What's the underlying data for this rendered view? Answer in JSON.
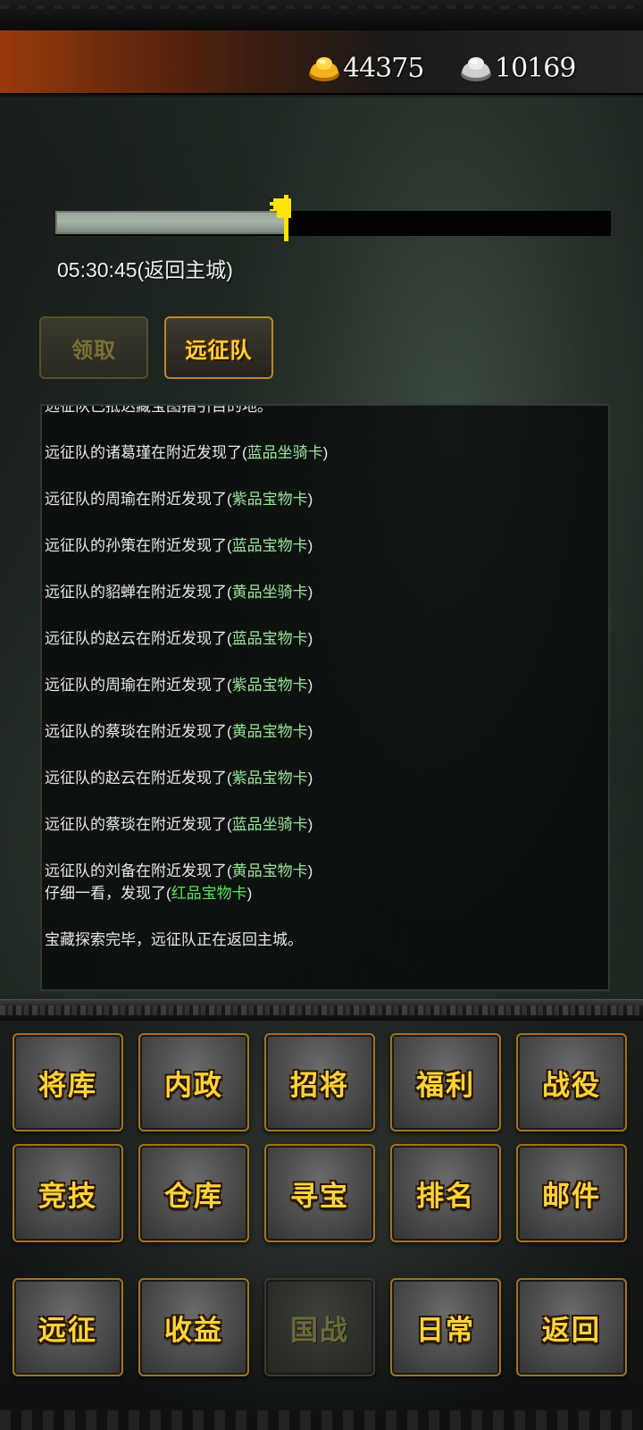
{
  "currency": {
    "gold": {
      "icon": "gold-ingot-icon",
      "value": "44375"
    },
    "silver": {
      "icon": "silver-ingot-icon",
      "value": "10169"
    }
  },
  "expedition": {
    "progress": 0.42,
    "timer_text": "05:30:45(返回主城)",
    "buttons": {
      "claim": "领取",
      "team": "远征队"
    }
  },
  "log": {
    "lines": [
      {
        "text": "远征队已抵达藏宝图指引目的地。"
      },
      {
        "text": "远征队的诸葛瑾在附近发现了(",
        "item": "蓝品坐骑卡",
        "tail": ")"
      },
      {
        "text": "远征队的周瑜在附近发现了(",
        "item": "紫品宝物卡",
        "tail": ")"
      },
      {
        "text": "远征队的孙策在附近发现了(",
        "item": "蓝品宝物卡",
        "tail": ")"
      },
      {
        "text": "远征队的貂蝉在附近发现了(",
        "item": "黄品坐骑卡",
        "tail": ")"
      },
      {
        "text": "远征队的赵云在附近发现了(",
        "item": "蓝品宝物卡",
        "tail": ")"
      },
      {
        "text": "远征队的周瑜在附近发现了(",
        "item": "紫品宝物卡",
        "tail": ")"
      },
      {
        "text": "远征队的蔡琰在附近发现了(",
        "item": "黄品宝物卡",
        "tail": ")"
      },
      {
        "text": "远征队的赵云在附近发现了(",
        "item": "紫品宝物卡",
        "tail": ")"
      },
      {
        "text": "远征队的蔡琰在附近发现了(",
        "item": "蓝品坐骑卡",
        "tail": ")"
      },
      {
        "text": "远征队的刘备在附近发现了(",
        "item": "黄品宝物卡",
        "tail": ")"
      }
    ],
    "bonus_line": {
      "text": "仔细一看，发现了(",
      "item": "红品宝物卡",
      "tail": ")"
    },
    "final_line": "宝藏探索完毕，远征队正在返回主城。"
  },
  "menu": {
    "row1": [
      "将库",
      "内政",
      "招将",
      "福利",
      "战役"
    ],
    "row2": [
      "竞技",
      "仓库",
      "寻宝",
      "排名",
      "邮件"
    ],
    "row3": [
      "远征",
      "收益",
      "国战",
      "日常",
      "返回"
    ]
  }
}
